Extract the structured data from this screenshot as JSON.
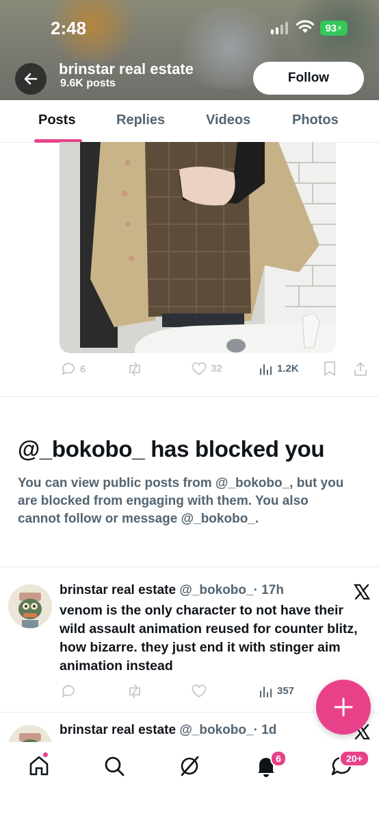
{
  "status_bar": {
    "time": "2:48",
    "battery": "93"
  },
  "header": {
    "name": "brinstar real estate",
    "posts_count": "9.6K posts",
    "follow_label": "Follow"
  },
  "tabs": [
    {
      "label": "Posts",
      "active": true
    },
    {
      "label": "Replies",
      "active": false
    },
    {
      "label": "Videos",
      "active": false
    },
    {
      "label": "Photos",
      "active": false
    }
  ],
  "first_post_actions": {
    "replies": "6",
    "likes": "32",
    "views": "1.2K"
  },
  "blocked_notice": {
    "title": "@_bokobo_ has blocked you",
    "body": "You can view public posts from @_bokobo_, but you are blocked from engaging with them. You also cannot follow or message @_bokobo_."
  },
  "tweets": [
    {
      "author": "brinstar real estate",
      "handle": "@_bokobo_",
      "time": "· 17h",
      "text": "venom is the only character to not have their wild assault animation reused for counter blitz, how bizarre. they just end it with stinger aim animation instead",
      "views": "357"
    },
    {
      "author": "brinstar real estate",
      "handle": "@_bokobo_",
      "time": "· 1d"
    }
  ],
  "bottom_nav": {
    "notifications_badge": "6",
    "messages_badge": "20+"
  },
  "colors": {
    "accent": "#e8418a",
    "secondary_text": "#536471",
    "text": "#0f1419",
    "battery": "#34c759"
  },
  "icons": [
    "back-arrow-icon",
    "reply-icon",
    "retweet-icon",
    "like-icon",
    "views-icon",
    "bookmark-icon",
    "share-icon",
    "x-logo-icon",
    "compose-plus-icon",
    "home-icon",
    "search-icon",
    "grok-icon",
    "bell-icon",
    "messages-icon"
  ]
}
